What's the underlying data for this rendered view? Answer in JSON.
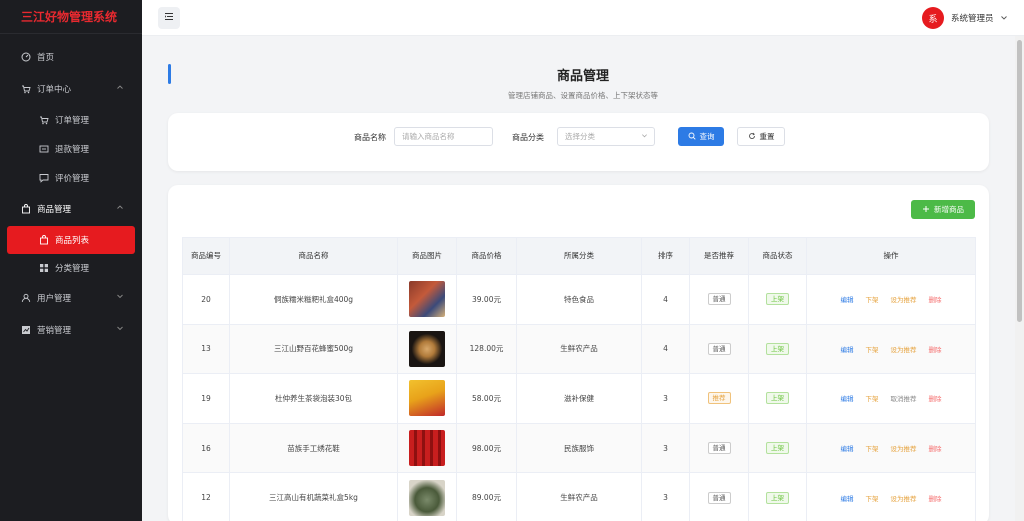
{
  "app": {
    "title": "三江好物管理系统"
  },
  "sidebar": {
    "items": [
      {
        "label": "首页",
        "icon": "dashboard-icon"
      },
      {
        "label": "订单中心",
        "icon": "cart-icon"
      },
      {
        "label": "订单管理",
        "icon": "cart-icon"
      },
      {
        "label": "退款管理",
        "icon": "refund-icon"
      },
      {
        "label": "评价管理",
        "icon": "comment-icon"
      },
      {
        "label": "商品管理",
        "icon": "bag-icon"
      },
      {
        "label": "商品列表",
        "icon": "bag-icon"
      },
      {
        "label": "分类管理",
        "icon": "grid-icon"
      },
      {
        "label": "用户管理",
        "icon": "user-icon"
      },
      {
        "label": "营销管理",
        "icon": "chart-icon"
      }
    ]
  },
  "header": {
    "avatar_text": "系",
    "user_name": "系统管理员"
  },
  "page": {
    "title": "商品管理",
    "subtitle": "管理店铺商品、设置商品价格、上下架状态等"
  },
  "search": {
    "name_label": "商品名称",
    "name_placeholder": "请输入商品名称",
    "category_label": "商品分类",
    "category_placeholder": "选择分类",
    "query_label": "查询",
    "reset_label": "重置"
  },
  "toolbar": {
    "add_label": "新增商品"
  },
  "table": {
    "columns": [
      "商品编号",
      "商品名称",
      "商品图片",
      "商品价格",
      "所属分类",
      "排序",
      "是否推荐",
      "商品状态",
      "操作"
    ],
    "rows": [
      {
        "id": "20",
        "name": "侗族糯米糍粑礼盒400g",
        "price": "39.00元",
        "category": "特色食品",
        "sort": "4",
        "recommend": "普通",
        "status": "上架",
        "ops": [
          "编辑",
          "下架",
          "设为推荐",
          "删除"
        ]
      },
      {
        "id": "13",
        "name": "三江山野百花蜂蜜500g",
        "price": "128.00元",
        "category": "生鲜农产品",
        "sort": "4",
        "recommend": "普通",
        "status": "上架",
        "ops": [
          "编辑",
          "下架",
          "设为推荐",
          "删除"
        ]
      },
      {
        "id": "19",
        "name": "杜仲养生茶袋泡装30包",
        "price": "58.00元",
        "category": "滋补保健",
        "sort": "3",
        "recommend": "推荐",
        "status": "上架",
        "ops": [
          "编辑",
          "下架",
          "取消推荐",
          "删除"
        ]
      },
      {
        "id": "16",
        "name": "苗族手工绣花鞋",
        "price": "98.00元",
        "category": "民族服饰",
        "sort": "3",
        "recommend": "普通",
        "status": "上架",
        "ops": [
          "编辑",
          "下架",
          "设为推荐",
          "删除"
        ]
      },
      {
        "id": "12",
        "name": "三江高山有机蔬菜礼盒5kg",
        "price": "89.00元",
        "category": "生鲜农产品",
        "sort": "3",
        "recommend": "普通",
        "status": "上架",
        "ops": [
          "编辑",
          "下架",
          "设为推荐",
          "删除"
        ]
      }
    ]
  },
  "colors": {
    "brand": "#e61b1f",
    "primary": "#2d7be5",
    "success": "#4cba47",
    "sidebar_bg": "#1c1d21"
  }
}
